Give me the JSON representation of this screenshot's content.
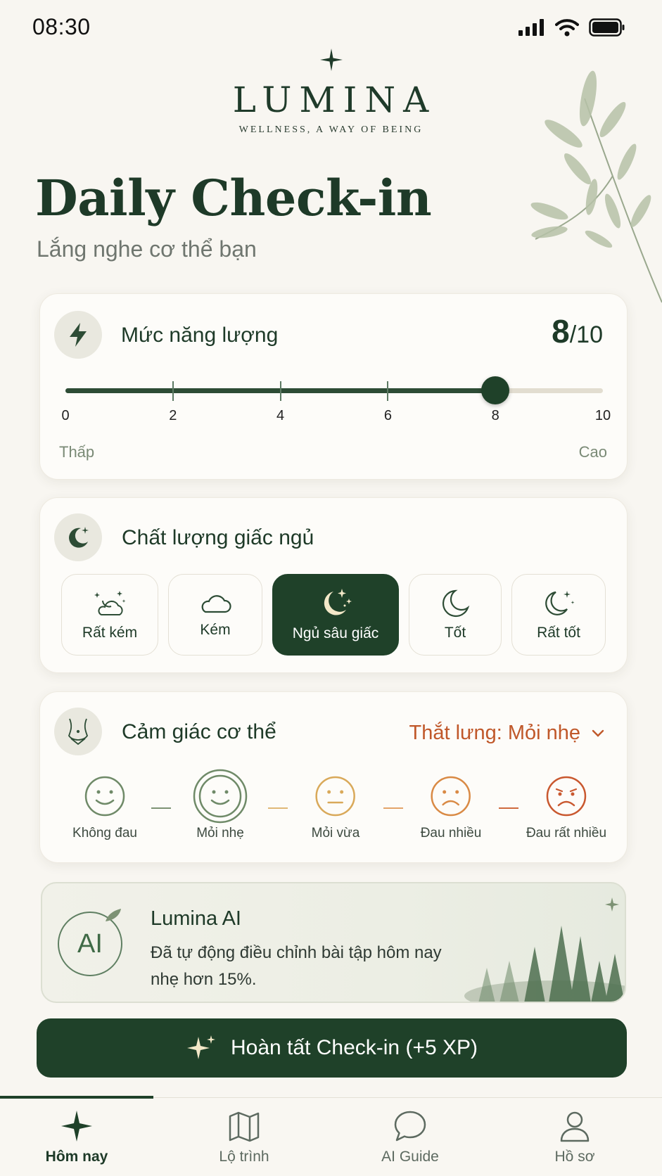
{
  "status_bar": {
    "time": "08:30"
  },
  "brand": {
    "name": "LUMINA",
    "tagline": "WELLNESS, A WAY OF BEING"
  },
  "header": {
    "title": "Daily Check-in",
    "subtitle": "Lắng nghe cơ thể bạn"
  },
  "energy": {
    "title": "Mức năng lượng",
    "value": "8",
    "max": "/10",
    "level": 8,
    "range": [
      0,
      10
    ],
    "ticks": [
      "0",
      "2",
      "4",
      "6",
      "8",
      "10"
    ],
    "low_label": "Thấp",
    "high_label": "Cao"
  },
  "sleep": {
    "title": "Chất lượng giấc ngủ",
    "options": [
      {
        "label": "Rất kém",
        "icon": "moon-cloud-stars-icon"
      },
      {
        "label": "Kém",
        "icon": "cloud-icon"
      },
      {
        "label": "Ngủ sâu giấc",
        "icon": "moon-stars-icon",
        "selected": true
      },
      {
        "label": "Tốt",
        "icon": "moon-icon"
      },
      {
        "label": "Rất tốt",
        "icon": "moon-sparkle-icon"
      }
    ]
  },
  "body": {
    "title": "Cảm giác cơ thể",
    "selected_part": "Thắt lưng: Mỏi nhẹ",
    "levels": [
      {
        "label": "Không đau",
        "color": "#6f8a68"
      },
      {
        "label": "Mỏi nhẹ",
        "color": "#6f8a68"
      },
      {
        "label": "Mỏi vừa",
        "color": "#d9a95a"
      },
      {
        "label": "Đau nhiều",
        "color": "#d98a45"
      },
      {
        "label": "Đau rất nhiều",
        "color": "#c9582f"
      }
    ]
  },
  "ai": {
    "badge": "AI",
    "title": "Lumina AI",
    "line1": "Đã tự động điều chỉnh bài tập hôm nay",
    "line2": "nhẹ hơn 15%."
  },
  "cta": {
    "label": "Hoàn tất Check-in (+5 XP)"
  },
  "nav": [
    {
      "label": "Hôm nay",
      "icon": "sparkle-icon",
      "active": true
    },
    {
      "label": "Lộ trình",
      "icon": "map-icon"
    },
    {
      "label": "AI Guide",
      "icon": "chat-bubble-icon"
    },
    {
      "label": "Hồ sơ",
      "icon": "user-icon"
    }
  ],
  "colors": {
    "primary": "#1f4129",
    "accent": "#c0582a",
    "background": "#f8f6f1"
  }
}
